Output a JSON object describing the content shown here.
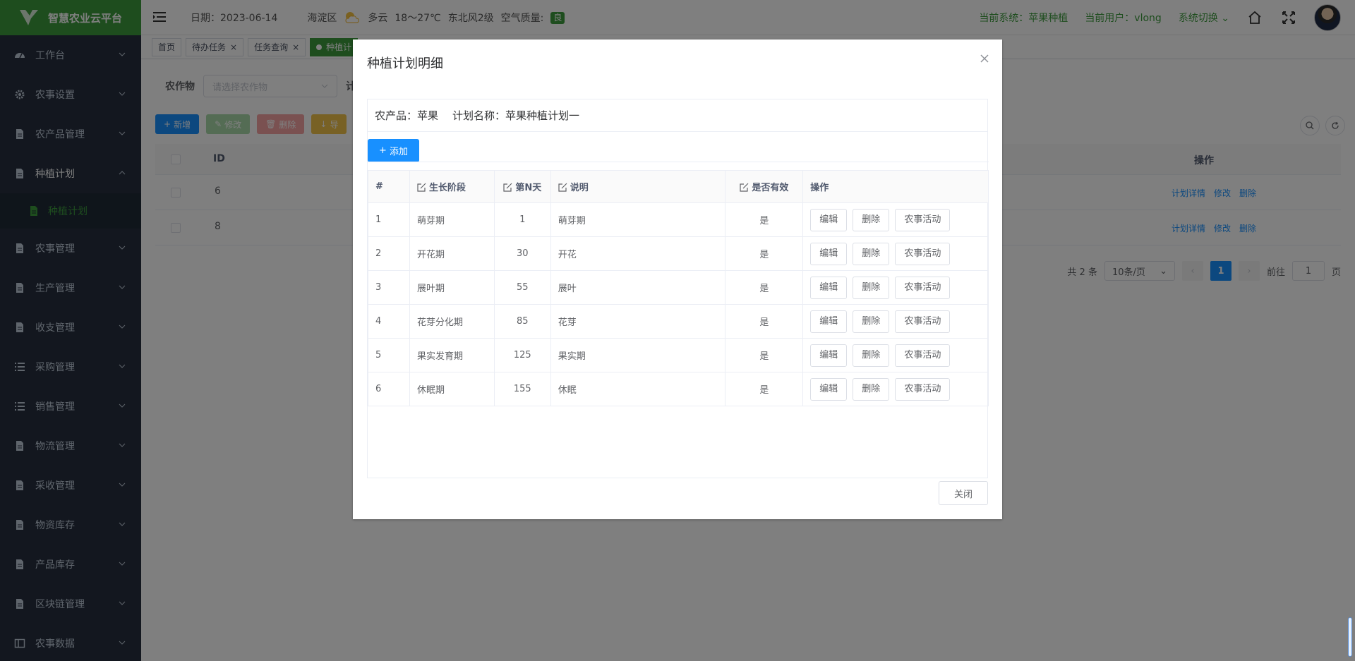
{
  "app": {
    "title": "智慧农业云平台"
  },
  "header": {
    "date": "日期：2023-06-14",
    "district": "海淀区",
    "weather": "多云",
    "temperature": "18～27℃",
    "wind": "东北风2级",
    "air_label": "空气质量:",
    "air_value": "良",
    "current_system": "当前系统：苹果种植",
    "current_user": "当前用户：vlong",
    "switch_system": "系统切换"
  },
  "sidebar": {
    "items": [
      {
        "label": "工作台",
        "icon": "dashboard-icon"
      },
      {
        "label": "农事设置",
        "icon": "gear-icon"
      },
      {
        "label": "农产品管理",
        "icon": "document-icon"
      },
      {
        "label": "种植计划",
        "icon": "document-icon",
        "expanded": true
      },
      {
        "label": "农事管理",
        "icon": "document-icon"
      },
      {
        "label": "生产管理",
        "icon": "document-icon"
      },
      {
        "label": "收支管理",
        "icon": "document-icon"
      },
      {
        "label": "采购管理",
        "icon": "list-icon"
      },
      {
        "label": "销售管理",
        "icon": "list-icon"
      },
      {
        "label": "物流管理",
        "icon": "document-icon"
      },
      {
        "label": "采收管理",
        "icon": "document-icon"
      },
      {
        "label": "物资库存",
        "icon": "document-icon"
      },
      {
        "label": "产品库存",
        "icon": "document-icon"
      },
      {
        "label": "区块链管理",
        "icon": "document-icon"
      },
      {
        "label": "农事数据",
        "icon": "columns-icon"
      }
    ],
    "subitem": "种植计划"
  },
  "tabs": [
    "首页",
    "待办任务",
    "任务查询",
    "种植计"
  ],
  "main": {
    "filter_label": "农作物",
    "filter_placeholder": "请选择农作物",
    "filter_label2": "计",
    "btn_add": "新增",
    "btn_edit": "修改",
    "btn_delete": "删除",
    "btn_export": "导",
    "col_id": "ID",
    "col_ops": "操作",
    "rows": [
      {
        "id": "6",
        "ops": [
          "计划详情",
          "修改",
          "删除"
        ]
      },
      {
        "id": "8",
        "ops": [
          "计划详情",
          "修改",
          "删除"
        ]
      }
    ],
    "pager": {
      "total": "共 2 条",
      "size": "10条/页",
      "page": "1",
      "goto": "前往",
      "goto_value": "1",
      "page_suffix": "页"
    }
  },
  "dialog": {
    "title": "种植计划明细",
    "product": "农产品：苹果",
    "plan_name": "计划名称：苹果种植计划一",
    "add_label": "添加",
    "columns": [
      "#",
      "生长阶段",
      "第N天",
      "说明",
      "是否有效",
      "操作"
    ],
    "rows": [
      {
        "no": "1",
        "stage": "萌芽期",
        "day": "1",
        "desc": "萌芽期",
        "valid": "是"
      },
      {
        "no": "2",
        "stage": "开花期",
        "day": "30",
        "desc": "开花",
        "valid": "是"
      },
      {
        "no": "3",
        "stage": "展叶期",
        "day": "55",
        "desc": "展叶",
        "valid": "是"
      },
      {
        "no": "4",
        "stage": "花芽分化期",
        "day": "85",
        "desc": "花芽",
        "valid": "是"
      },
      {
        "no": "5",
        "stage": "果实发育期",
        "day": "125",
        "desc": "果实期",
        "valid": "是"
      },
      {
        "no": "6",
        "stage": "休眠期",
        "day": "155",
        "desc": "休眠",
        "valid": "是"
      }
    ],
    "row_ops": [
      "编辑",
      "删除",
      "农事活动"
    ],
    "close_label": "关闭"
  },
  "colors": {
    "brand": "#3c9a3d",
    "primary": "#1890ff",
    "sidebar_bg": "#262f3e"
  }
}
